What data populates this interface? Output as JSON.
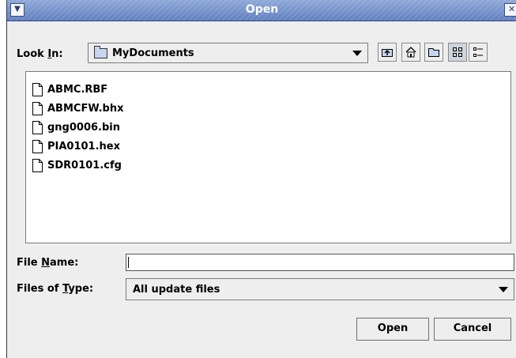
{
  "dialog": {
    "title": "Open"
  },
  "lookin": {
    "label_pre": "Look ",
    "label_mnemonic": "I",
    "label_post": "n:",
    "value": "MyDocuments"
  },
  "toolbar": {
    "icons": [
      "up-one-level-icon",
      "home-icon",
      "new-folder-icon",
      "list-view-icon",
      "details-view-icon"
    ],
    "active_view": "list"
  },
  "files": [
    {
      "name": "ABMC.RBF"
    },
    {
      "name": "ABMCFW.bhx"
    },
    {
      "name": "gng0006.bin"
    },
    {
      "name": "PIA0101.hex"
    },
    {
      "name": "SDR0101.cfg"
    }
  ],
  "filename": {
    "label_pre": "File ",
    "label_mnemonic": "N",
    "label_post": "ame:",
    "value": ""
  },
  "filetype": {
    "label_pre": "Files of ",
    "label_mnemonic": "T",
    "label_post": "ype:",
    "value": "All update files"
  },
  "buttons": {
    "open": "Open",
    "cancel": "Cancel"
  },
  "colors": {
    "titlebar": "#7b96cc",
    "background": "#eeeeee",
    "list_bg": "#ffffff"
  }
}
